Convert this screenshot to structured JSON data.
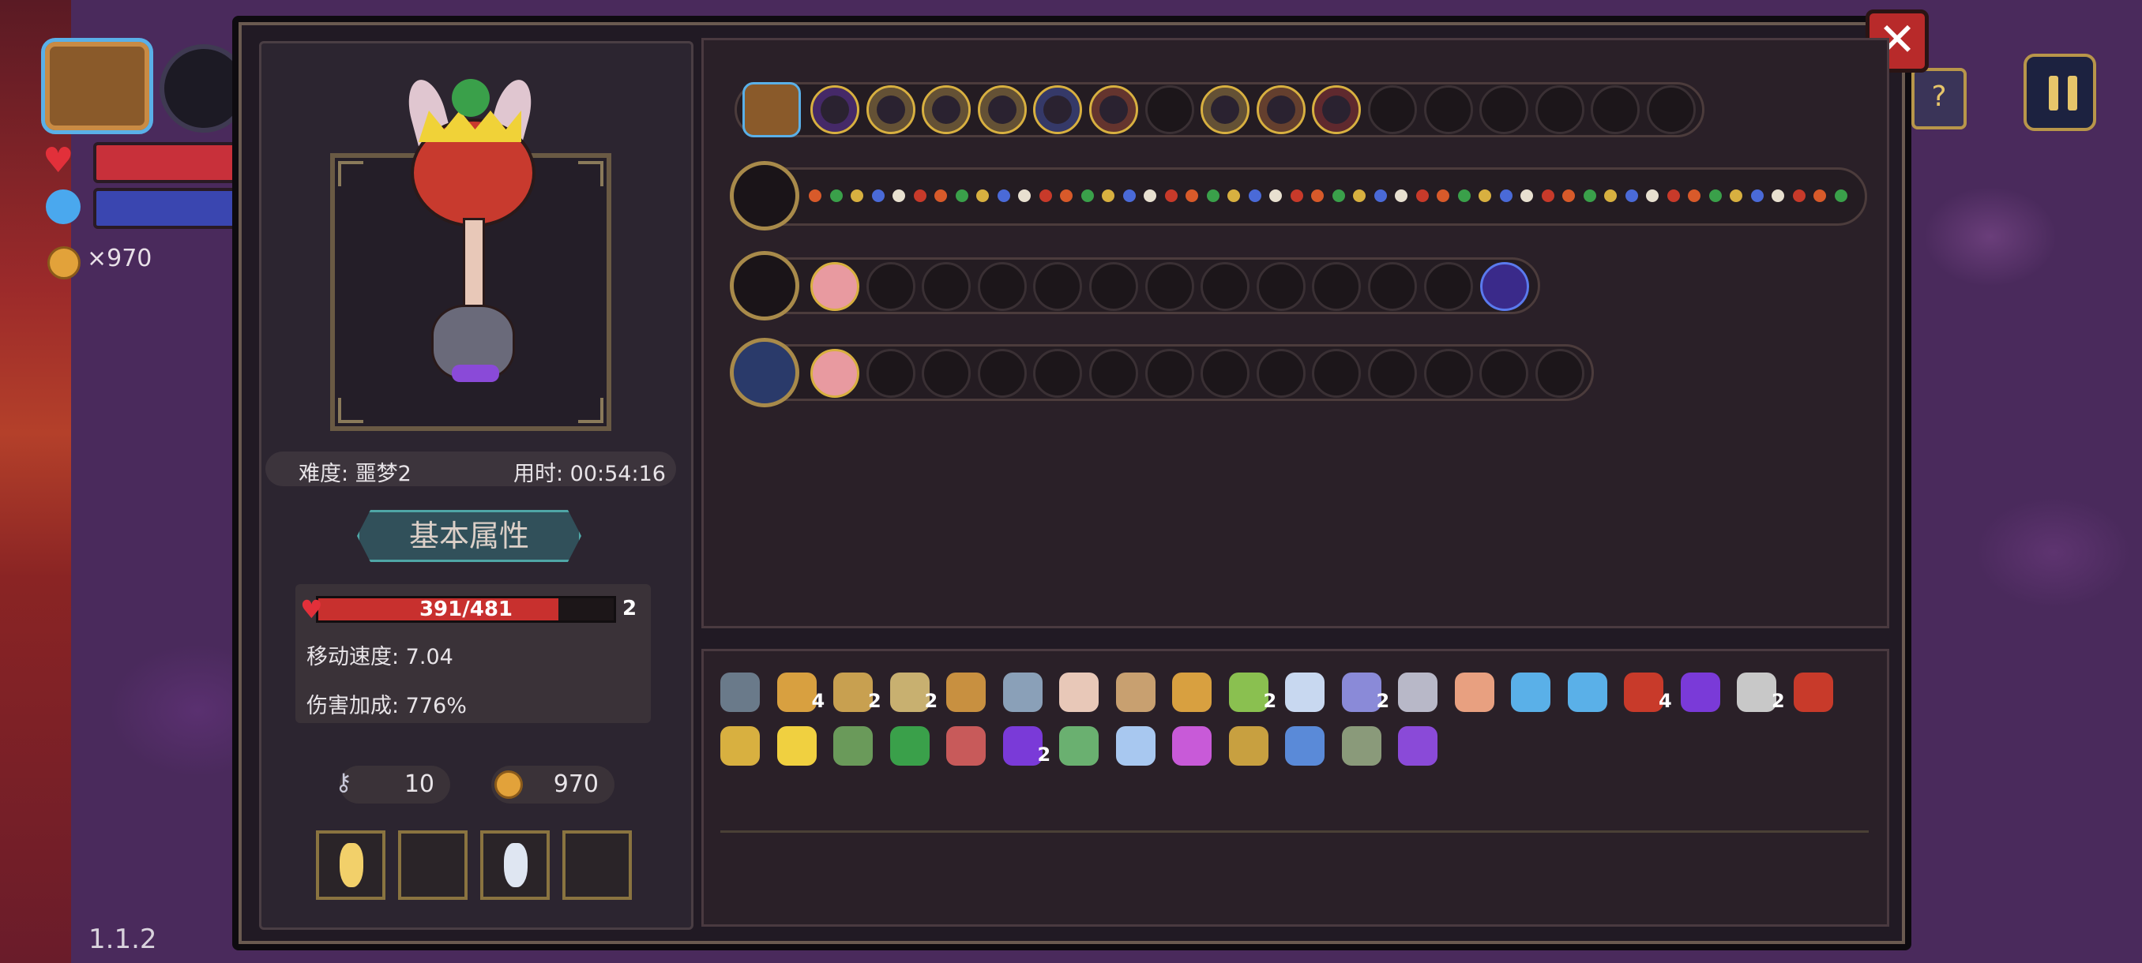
{
  "hud": {
    "gold_label": "×970",
    "version": "1.1.2"
  },
  "panel": {
    "close_label": "✕",
    "difficulty": "难度: 噩梦2",
    "time": "用时: 00:54:16",
    "attr_title": "基本属性",
    "hp_text": "391/481",
    "hp_level": "2",
    "hp_fraction": 0.813,
    "move_speed": "移动速度: 7.04",
    "damage_bonus": "伤害加成: 776%",
    "keys": "10",
    "gold": "970"
  },
  "colors": {
    "accent_gold": "#d8b040",
    "hp_red": "#c8302e",
    "attr_teal": "#4fa6a6"
  },
  "item_counts": [
    "4",
    "2",
    "2",
    "2",
    "2",
    "4",
    "2",
    "2"
  ]
}
